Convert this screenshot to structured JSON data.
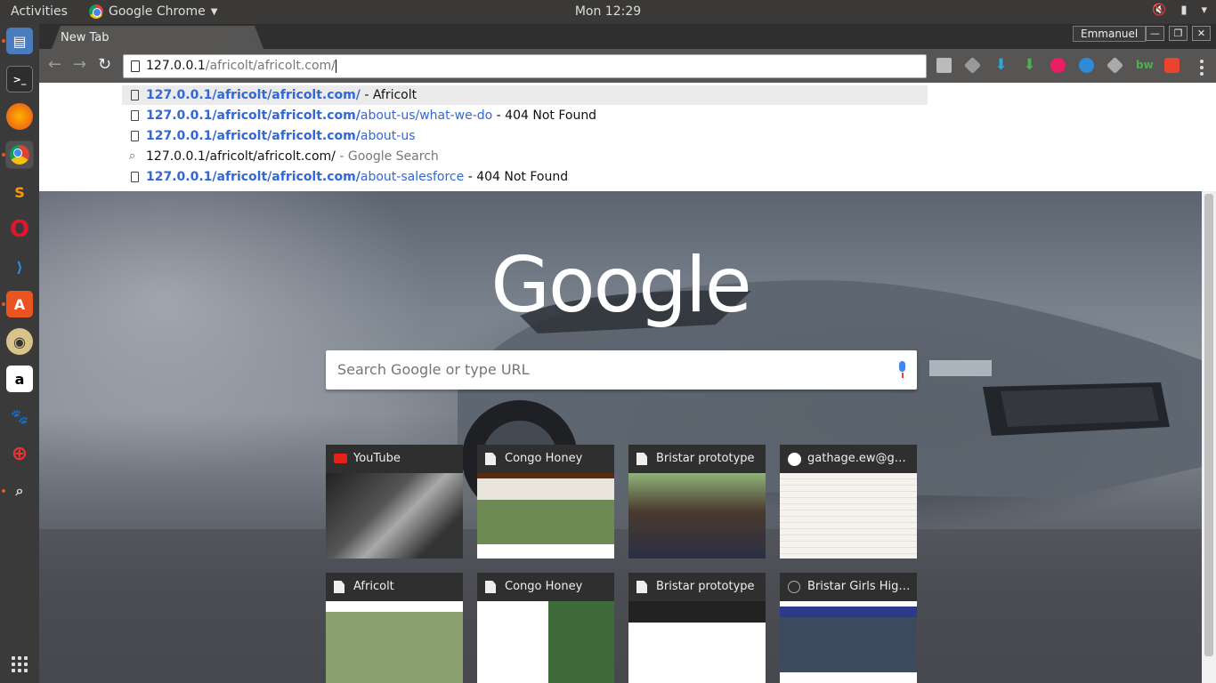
{
  "topbar": {
    "activities": "Activities",
    "app_name": "Google Chrome",
    "clock": "Mon 12:29"
  },
  "dock": {
    "items": [
      "files-icon",
      "terminal-icon",
      "firefox-icon",
      "chrome-icon",
      "sublime-icon",
      "opera-icon",
      "vscode-icon",
      "software-center-icon",
      "rhythmbox-icon",
      "amazon-icon",
      "gimp-icon",
      "help-icon",
      "screenshot-icon"
    ],
    "show_apps": "show-apps-icon"
  },
  "tabs": [
    {
      "title": "New Tab"
    }
  ],
  "window": {
    "user": "Emmanuel"
  },
  "omnibox": {
    "host": "127.0.0.1",
    "path": "/africolt/africolt.com/"
  },
  "suggestions": [
    {
      "type": "page",
      "bold": "127.0.0.1/africolt/africolt.com/",
      "rest": "",
      "title": "Africolt"
    },
    {
      "type": "page",
      "bold": "127.0.0.1/africolt/africolt.com/",
      "rest": "about-us/what-we-do",
      "title": "404 Not Found"
    },
    {
      "type": "page",
      "bold": "127.0.0.1/africolt/africolt.com/",
      "rest": "about-us",
      "title": ""
    },
    {
      "type": "search",
      "query": "127.0.0.1/africolt/africolt.com/",
      "title": "Google Search"
    },
    {
      "type": "page",
      "bold": "127.0.0.1/africolt/africolt.com/",
      "rest": "about-salesforce",
      "title": "404 Not Found"
    }
  ],
  "newtab": {
    "logo": "Google",
    "search_placeholder": "Search Google or type URL",
    "tiles": [
      {
        "title": "YouTube",
        "icon": "youtube-icon"
      },
      {
        "title": "Congo Honey",
        "icon": "page-icon"
      },
      {
        "title": "Bristar prototype",
        "icon": "page-icon"
      },
      {
        "title": "gathage.ew@gmail.com",
        "icon": "google-icon"
      },
      {
        "title": "Africolt",
        "icon": "page-icon"
      },
      {
        "title": "Congo Honey",
        "icon": "page-icon"
      },
      {
        "title": "Bristar prototype",
        "icon": "page-icon"
      },
      {
        "title": "Bristar Girls High School",
        "icon": "globe-icon"
      }
    ]
  },
  "colors": {
    "link": "#3367d6",
    "toolbar": "#565553",
    "accent": "#e65a1e"
  }
}
